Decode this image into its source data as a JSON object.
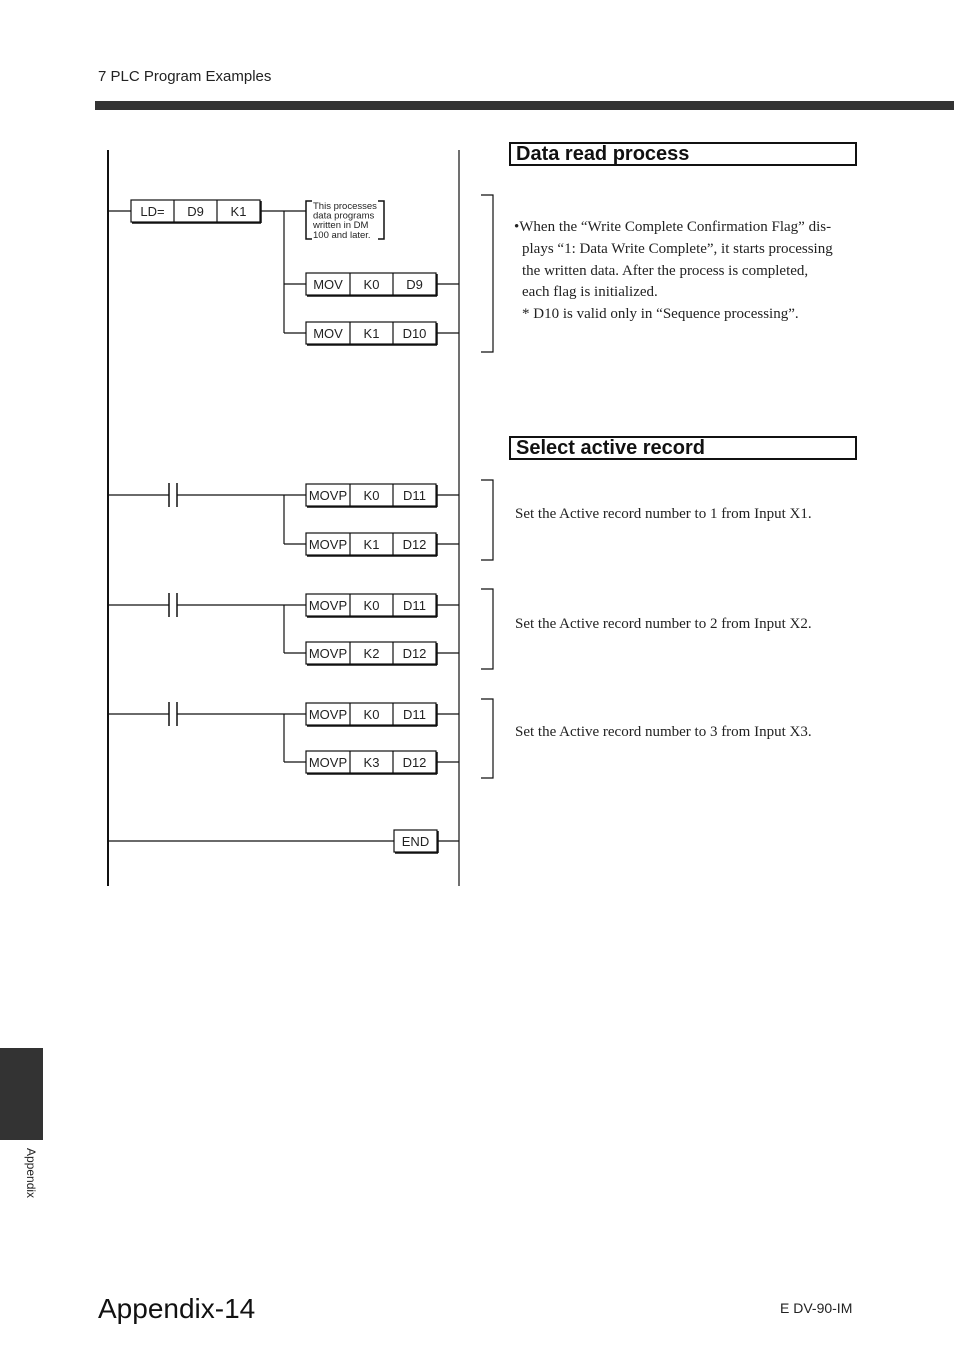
{
  "header": {
    "section_title": "7  PLC Program Examples"
  },
  "ladder": {
    "rungs": [
      {
        "condition": {
          "type": "compare",
          "cells": [
            "LD=",
            "D9",
            "K1"
          ]
        },
        "note": [
          "This processes",
          "data programs",
          "written in DM",
          "100 and later."
        ],
        "outputs": [
          {
            "cells": [
              "MOV",
              "K0",
              "D9"
            ]
          },
          {
            "cells": [
              "MOV",
              "K1",
              "D10"
            ]
          }
        ]
      },
      {
        "condition": {
          "type": "contact"
        },
        "outputs": [
          {
            "cells": [
              "MOVP",
              "K0",
              "D11"
            ]
          },
          {
            "cells": [
              "MOVP",
              "K1",
              "D12"
            ]
          }
        ]
      },
      {
        "condition": {
          "type": "contact"
        },
        "outputs": [
          {
            "cells": [
              "MOVP",
              "K0",
              "D11"
            ]
          },
          {
            "cells": [
              "MOVP",
              "K2",
              "D12"
            ]
          }
        ]
      },
      {
        "condition": {
          "type": "contact"
        },
        "outputs": [
          {
            "cells": [
              "MOVP",
              "K0",
              "D11"
            ]
          },
          {
            "cells": [
              "MOVP",
              "K3",
              "D12"
            ]
          }
        ]
      }
    ],
    "end_label": "END"
  },
  "sections": {
    "data_read": {
      "title": "Data read process",
      "lines": [
        "•When the “Write Complete Confirmation Flag” dis-",
        "plays “1: Data Write Complete”, it starts processing",
        "the written data. After the process is completed,",
        "each flag is initialized.",
        "* D10 is valid only in “Sequence processing”."
      ]
    },
    "select_record": {
      "title": "Select active record",
      "items": [
        "Set the Active record number to 1 from Input X1.",
        "Set the Active record number to 2 from Input X2.",
        "Set the Active record number to 3 from Input X3."
      ]
    }
  },
  "footer": {
    "side_tab_label": "Appendix",
    "page_number": "Appendix-14",
    "doc_code": "E DV-90-IM"
  }
}
